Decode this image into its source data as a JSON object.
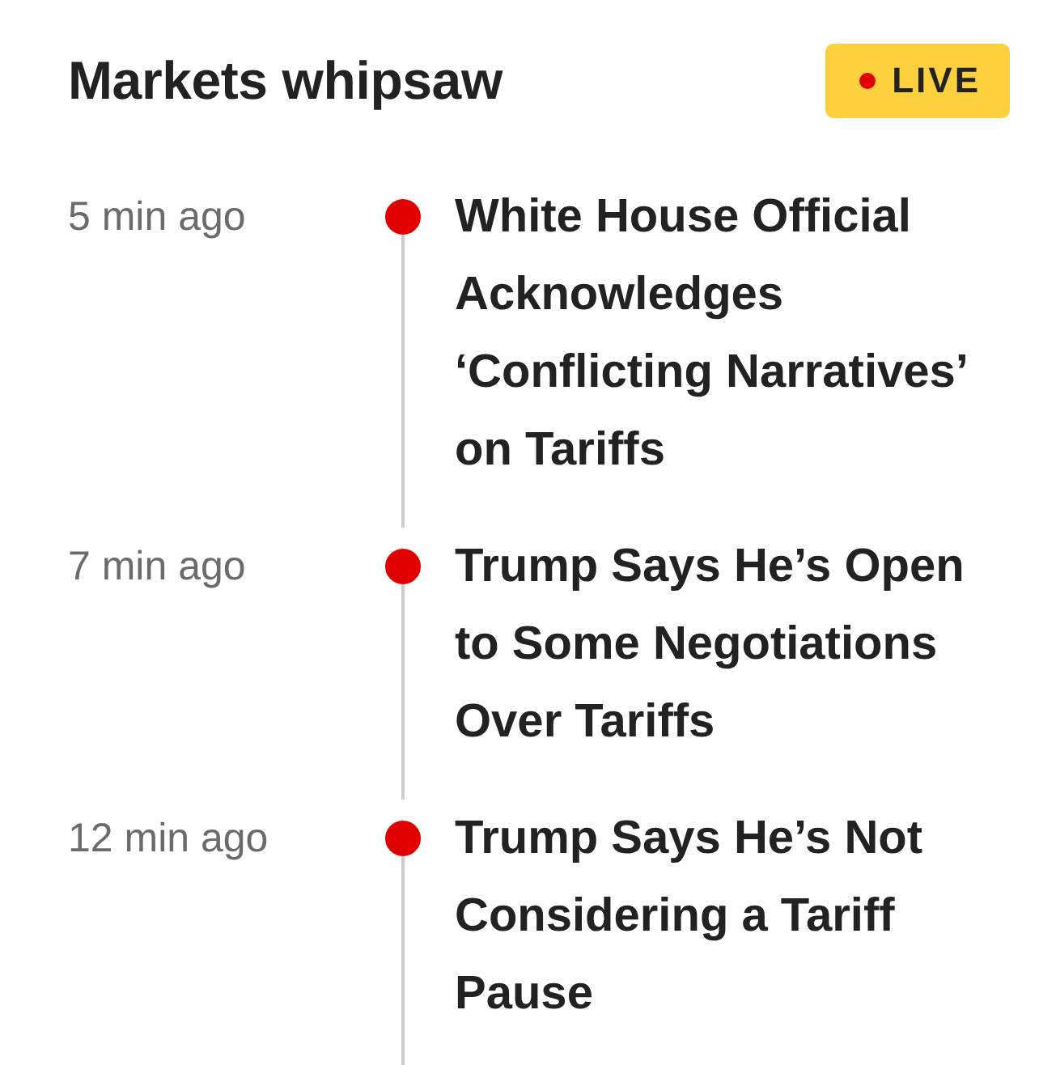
{
  "header": {
    "title": "Markets whipsaw",
    "badge": {
      "label": "LIVE"
    }
  },
  "items": [
    {
      "time": "5 min ago",
      "headline": "White House Official Acknowledges ‘Conflicting Narratives’ on Tariffs"
    },
    {
      "time": "7 min ago",
      "headline": "Trump Says He’s Open to Some Negotiations Over Tariffs"
    },
    {
      "time": "12 min ago",
      "headline": "Trump Says He’s Not Considering a Tariff Pause"
    }
  ]
}
